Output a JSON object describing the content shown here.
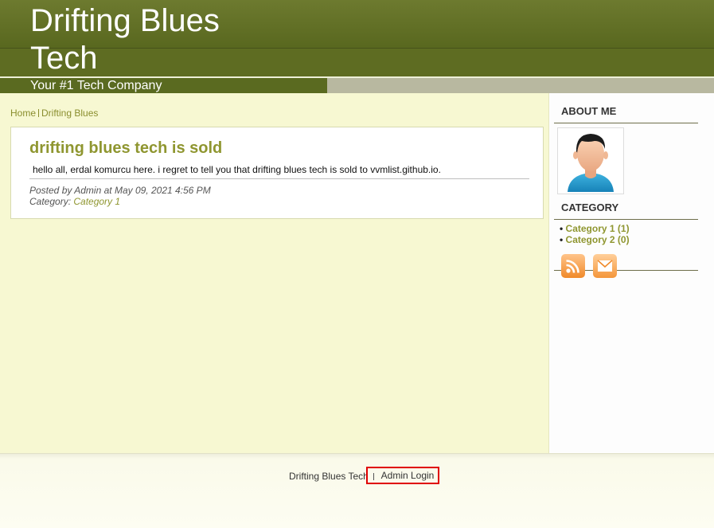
{
  "header": {
    "title": "Drifting Blues Tech",
    "tagline": "Your #1 Tech Company"
  },
  "breadcrumb": {
    "home": "Home",
    "current": "Drifting Blues"
  },
  "post": {
    "title": "drifting blues tech is sold",
    "body": "hello all, erdal komurcu here. i regret to tell you that drifting blues tech is sold to vvmlist.github.io.",
    "meta_posted": "Posted by Admin at May 09, 2021 4:56 PM",
    "meta_category_prefix": "Category: ",
    "meta_category_link": "Category 1"
  },
  "sidebar": {
    "about_heading": "ABOUT ME",
    "category_heading": "CATEGORY",
    "categories": [
      {
        "label": "Category 1 (1)"
      },
      {
        "label": "Category 2 (0)"
      }
    ],
    "icons": [
      "rss-icon",
      "mail-icon"
    ]
  },
  "footer": {
    "site_name": "Drifting Blues Tech",
    "admin_login": "Admin Login"
  },
  "colors": {
    "header_green": "#59681f",
    "content_bg": "#f7f8d2",
    "link_olive": "#8f9630",
    "highlight_red": "#e00000"
  }
}
